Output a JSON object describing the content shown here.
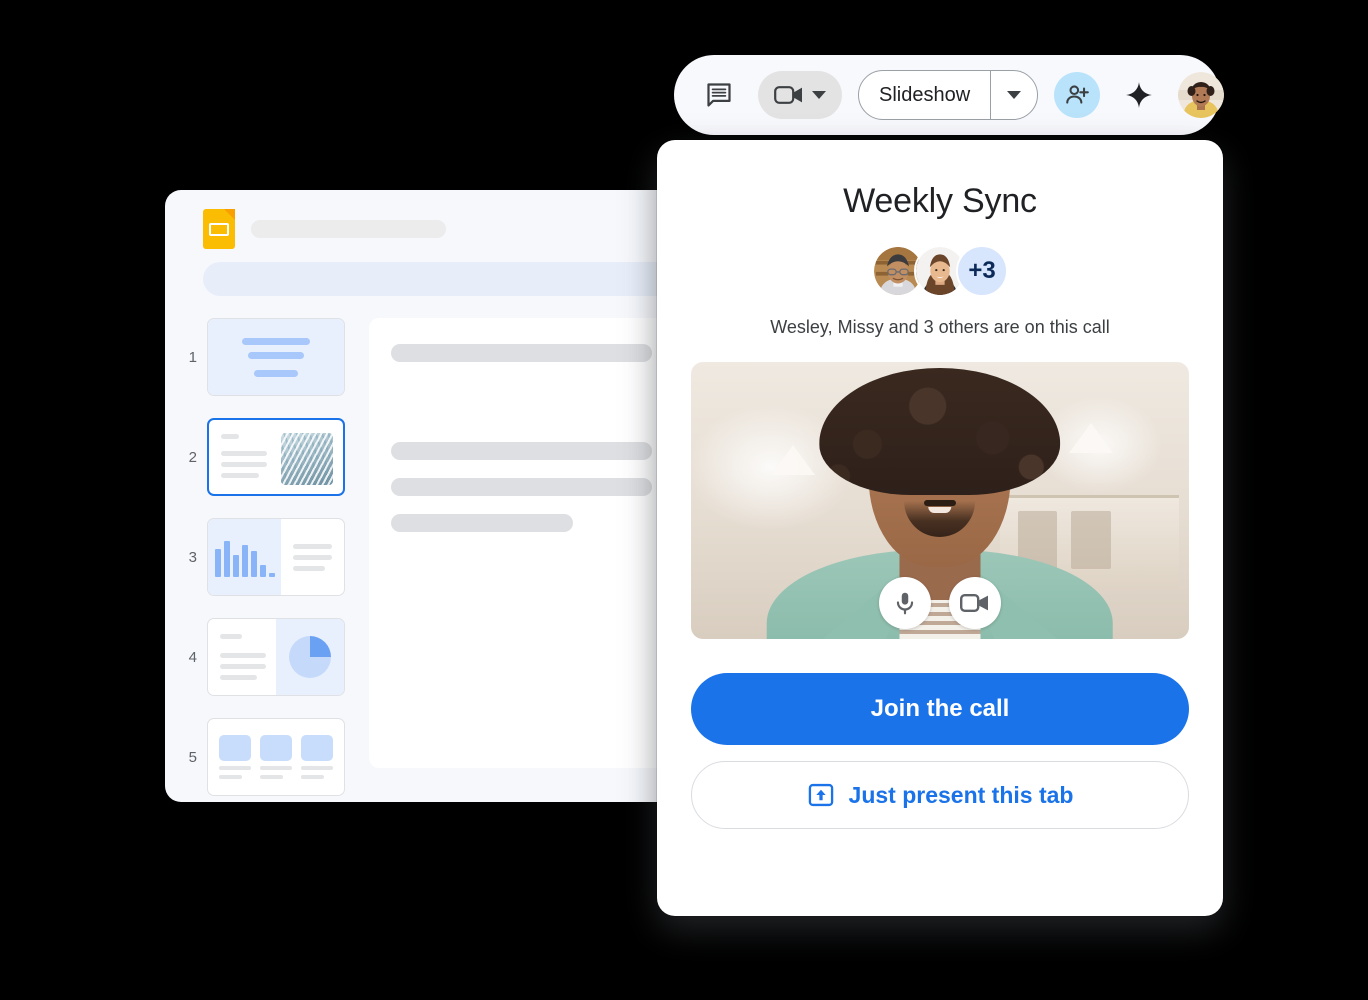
{
  "slides_window": {
    "app_icon": "google-slides-icon",
    "doc_title_placeholder": "",
    "thumbnails": [
      {
        "number": "1",
        "kind": "title-slide"
      },
      {
        "number": "2",
        "kind": "text-image-slide",
        "selected": true
      },
      {
        "number": "3",
        "kind": "bar-chart-slide"
      },
      {
        "number": "4",
        "kind": "pie-chart-slide"
      },
      {
        "number": "5",
        "kind": "three-cards-slide"
      }
    ]
  },
  "toolbar": {
    "chat_icon": "chat-bubble-icon",
    "camera_icon": "video-camera-icon",
    "camera_caret_icon": "chevron-down-icon",
    "slideshow_label": "Slideshow",
    "slideshow_caret_icon": "chevron-down-icon",
    "add_person_icon": "person-add-icon",
    "sparkle_icon": "gemini-sparkle-icon",
    "account_avatar": "user-avatar"
  },
  "meet_card": {
    "title": "Weekly Sync",
    "participants": {
      "overflow_badge": "+3",
      "summary": "Wesley, Missy and 3 others are on this call"
    },
    "video": {
      "mic_icon": "microphone-icon",
      "camera_icon": "video-camera-icon"
    },
    "primary_button": {
      "label": "Join the call"
    },
    "secondary_button": {
      "label": "Just present this tab",
      "icon": "present-to-screen-icon"
    }
  },
  "colors": {
    "accent_blue": "#1a73e8",
    "light_blue": "#e8f0fe",
    "badge_blue": "#d7e5fd",
    "slides_yellow": "#fbbc04",
    "surface": "#f6f8fc"
  }
}
